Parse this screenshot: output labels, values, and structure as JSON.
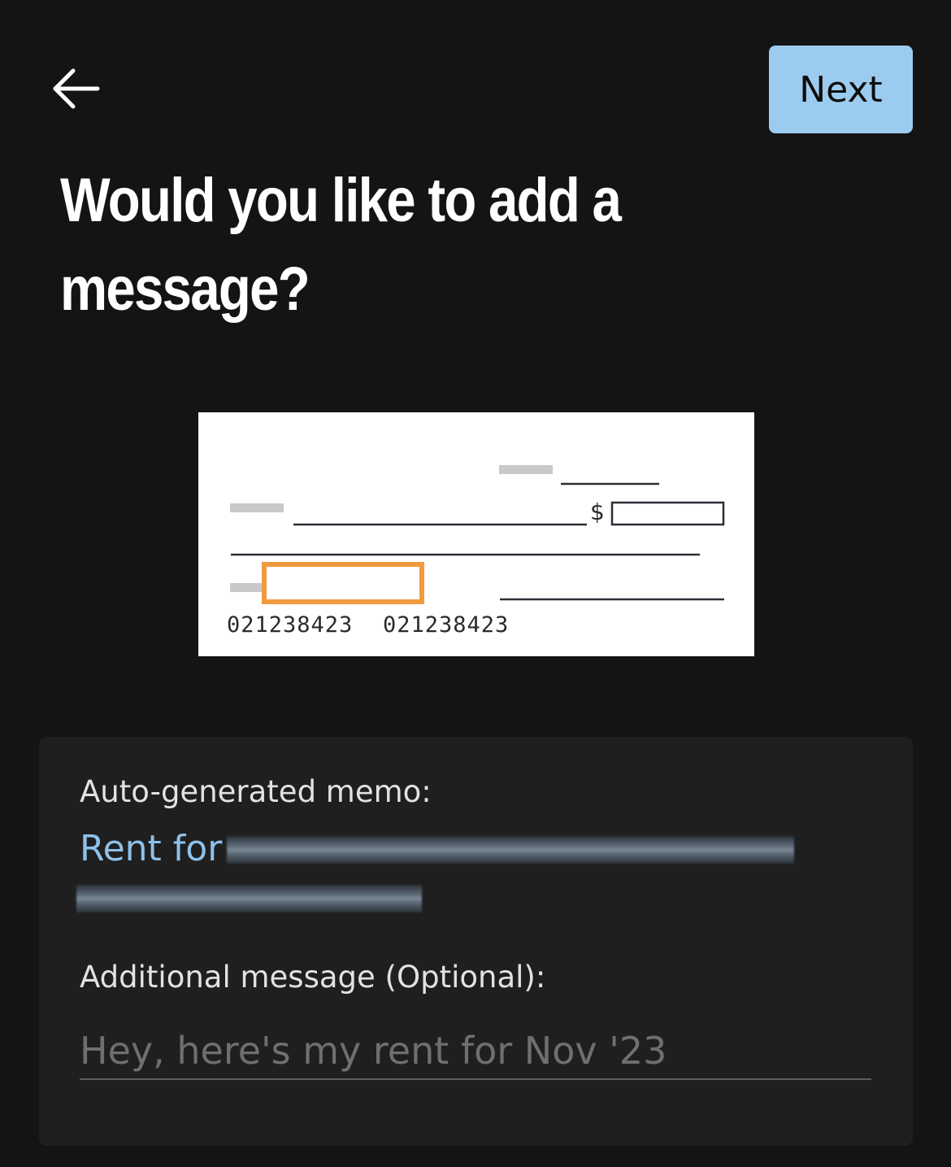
{
  "header": {
    "back_icon": "arrow-left-icon",
    "next_label": "Next",
    "next_color": "#9ccbf0"
  },
  "title": "Would you like to add a message?",
  "check_illustration": {
    "currency_symbol": "$",
    "routing_number": "021238423",
    "account_number": "021238423",
    "highlight_color": "#f19a3e"
  },
  "memo_panel": {
    "auto_memo_label": "Auto-generated memo:",
    "auto_memo_value": "Rent for",
    "memo_color": "#8ec1ea",
    "additional_label": "Additional message (Optional):",
    "additional_placeholder": "Hey, here's my rent for Nov '23"
  }
}
